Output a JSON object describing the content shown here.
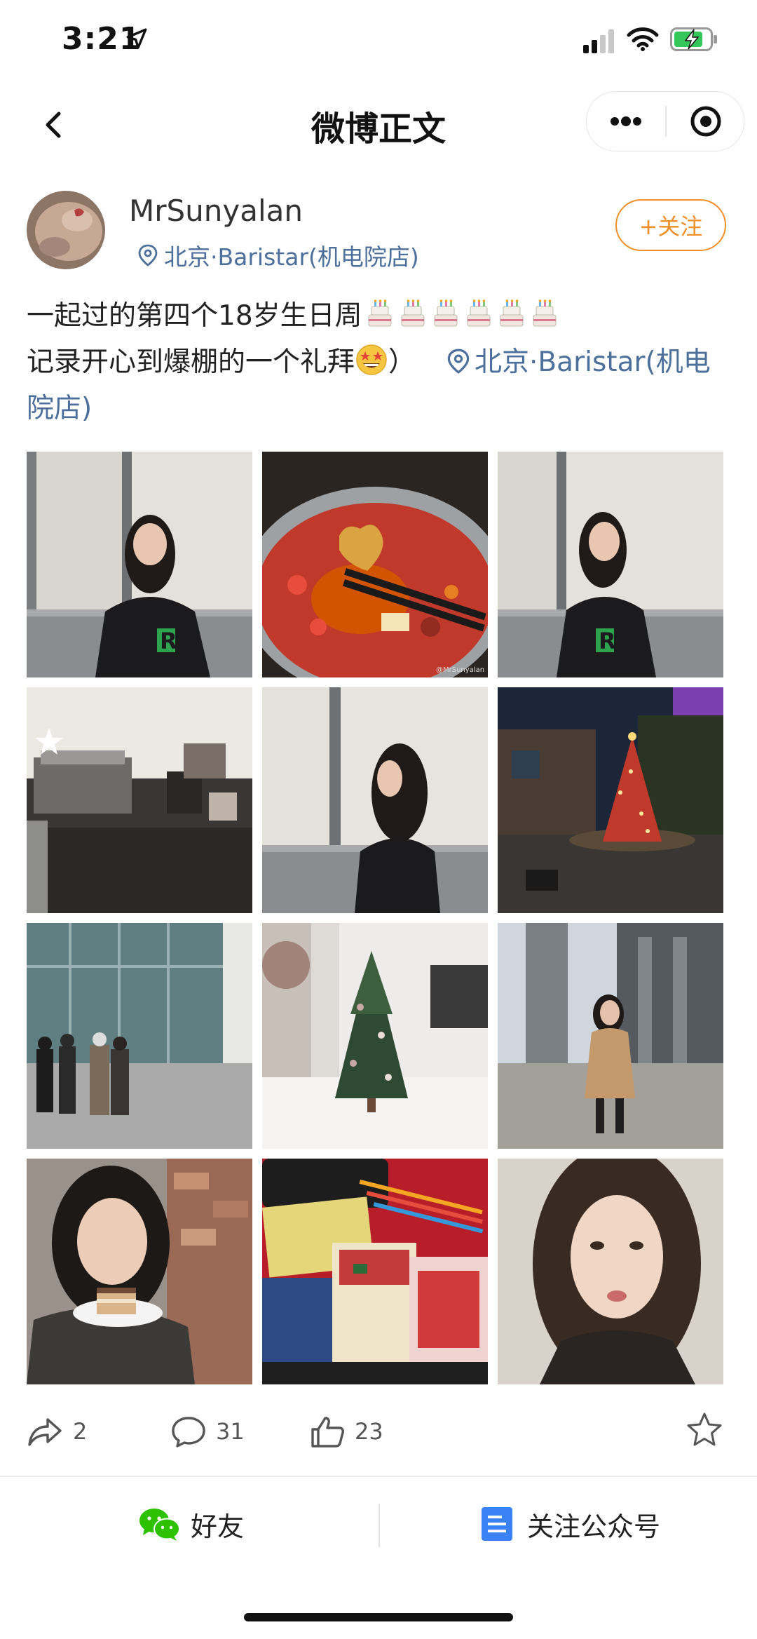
{
  "status_bar": {
    "time": "3:21"
  },
  "nav": {
    "title": "微博正文"
  },
  "post": {
    "author": "MrSunyalan",
    "location": "北京·Baristar(机电院店)",
    "follow_label": "+关注",
    "text_line1": "一起过的第四个18岁生日周",
    "text_line2": "记录开心到爆棚的一个礼拜",
    "text_line2_suffix": "）",
    "inline_location": "北京·Baristar(机电院店)",
    "cake_emoji_count": 6,
    "watermark": "@MrSunyalan",
    "images": [
      "girl-black-sweater-wall",
      "hotpot-chopsticks",
      "girl-black-sweater-side",
      "coffee-machine-counter",
      "girl-profile-wall",
      "christmas-tree-night",
      "friends-glass-building",
      "christmas-tree-store",
      "girl-beige-coat-street",
      "girl-with-cake",
      "christmas-cards-table",
      "girl-portrait"
    ]
  },
  "actions": {
    "repost_count": "2",
    "comment_count": "31",
    "like_count": "23"
  },
  "share": {
    "friends_label": "好友",
    "follow_account_label": "关注公众号"
  },
  "colors": {
    "link": "#4d6f9b",
    "follow": "#f0902b",
    "wechat_green": "#2dc100",
    "doc_blue": "#3b82f6"
  }
}
